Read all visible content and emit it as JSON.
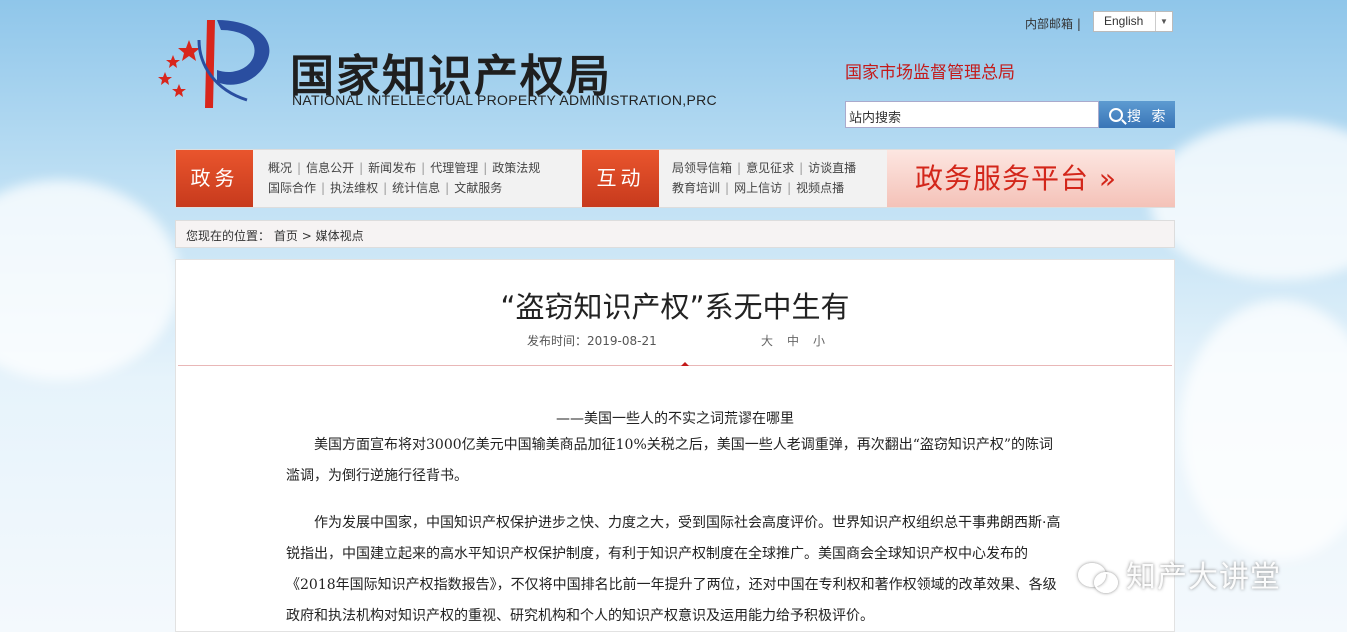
{
  "header": {
    "title_cn": "国家知识产权局",
    "title_en": "NATIONAL INTELLECTUAL PROPERTY ADMINISTRATION,PRC",
    "internal_mail": "内部邮箱 |",
    "language": "English",
    "parent_org": "国家市场监督管理总局",
    "search_placeholder": "站内搜索",
    "search_button": "搜 索"
  },
  "nav": {
    "gov_tag": "政务",
    "gov_links_row1": [
      "概况",
      "信息公开",
      "新闻发布",
      "代理管理",
      "政策法规"
    ],
    "gov_links_row2": [
      "国际合作",
      "执法维权",
      "统计信息",
      "文献服务"
    ],
    "interact_tag": "互动",
    "interact_links_row1": [
      "局领导信箱",
      "意见征求",
      "访谈直播"
    ],
    "interact_links_row2": [
      "教育培训",
      "网上信访",
      "视频点播"
    ],
    "platform_label": "政务服务平台 »"
  },
  "breadcrumb": {
    "prefix": "您现在的位置：",
    "home": "首页",
    "sep": ">",
    "current": "媒体视点"
  },
  "article": {
    "title": "“盗窃知识产权”系无中生有",
    "publish_time": "发布时间：2019-08-21",
    "font_sizes": [
      "大",
      "中",
      "小"
    ],
    "subtitle": "——美国一些人的不实之词荒谬在哪里",
    "paragraphs": [
      "美国方面宣布将对3000亿美元中国输美商品加征10%关税之后，美国一些人老调重弹，再次翻出“盗窃知识产权”的陈词滥调，为倒行逆施行径背书。",
      "作为发展中国家，中国知识产权保护进步之快、力度之大，受到国际社会高度评价。世界知识产权组织总干事弗朗西斯·高锐指出，中国建立起来的高水平知识产权保护制度，有利于知识产权制度在全球推广。美国商会全球知识产权中心发布的《2018年国际知识产权指数报告》，不仅将中国排名比前一年提升了两位，还对中国在专利权和著作权领域的改革效果、各级政府和执法机构对知识产权的重视、研究机构和个人的知识产权意识及运用能力给予积极评价。"
    ]
  },
  "watermark": "知产大讲堂",
  "colors": {
    "accent_red": "#c41a1a",
    "nav_tag": "#d9461f",
    "search_blue": "#3975b7"
  }
}
